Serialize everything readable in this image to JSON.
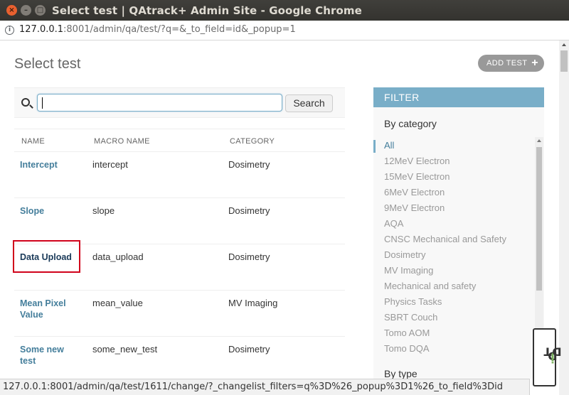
{
  "window": {
    "title": "Select test | QAtrack+ Admin Site - Google Chrome",
    "close_glyph": "×",
    "min_glyph": "–",
    "max_glyph": "□"
  },
  "address_bar": {
    "host": "127.0.0.1",
    "path": ":8001/admin/qa/test/?q=&_to_field=id&_popup=1",
    "icon": "info-icon",
    "icon_glyph": "i"
  },
  "page": {
    "title": "Select test",
    "add_button": "ADD TEST",
    "add_button_icon": "+"
  },
  "search": {
    "value": "",
    "button": "Search"
  },
  "table": {
    "columns": [
      "NAME",
      "MACRO NAME",
      "CATEGORY"
    ],
    "rows": [
      {
        "name": "Intercept",
        "macro": "intercept",
        "category": "Dosimetry"
      },
      {
        "name": "Slope",
        "macro": "slope",
        "category": "Dosimetry"
      },
      {
        "name": "Data Upload",
        "macro": "data_upload",
        "category": "Dosimetry"
      },
      {
        "name": "Mean Pixel Value",
        "macro": "mean_value",
        "category": "MV Imaging"
      },
      {
        "name": "Some new test",
        "macro": "some_new_test",
        "category": "Dosimetry"
      }
    ]
  },
  "filter": {
    "header": "FILTER",
    "by_category": "By category",
    "categories": [
      "All",
      "12MeV Electron",
      "15MeV Electron",
      "6MeV Electron",
      "9MeV Electron",
      "AQA",
      "CNSC Mechanical and Safety",
      "Dosimetry",
      "MV Imaging",
      "Mechanical and safety",
      "Physics Tasks",
      "SBRT Couch",
      "Tomo AOM",
      "Tomo DQA"
    ],
    "selected": "All",
    "by_type": "By type"
  },
  "djdt": {
    "prefix": "D",
    "accent": "j",
    "suffix": "DT"
  },
  "status_bar": "127.0.0.1:8001/admin/qa/test/1611/change/?_changelist_filters=q%3D%26_popup%3D1%26_to_field%3Did",
  "colors": {
    "accent": "#79aec8",
    "link": "#447e9b",
    "highlight": "#d0021b"
  }
}
